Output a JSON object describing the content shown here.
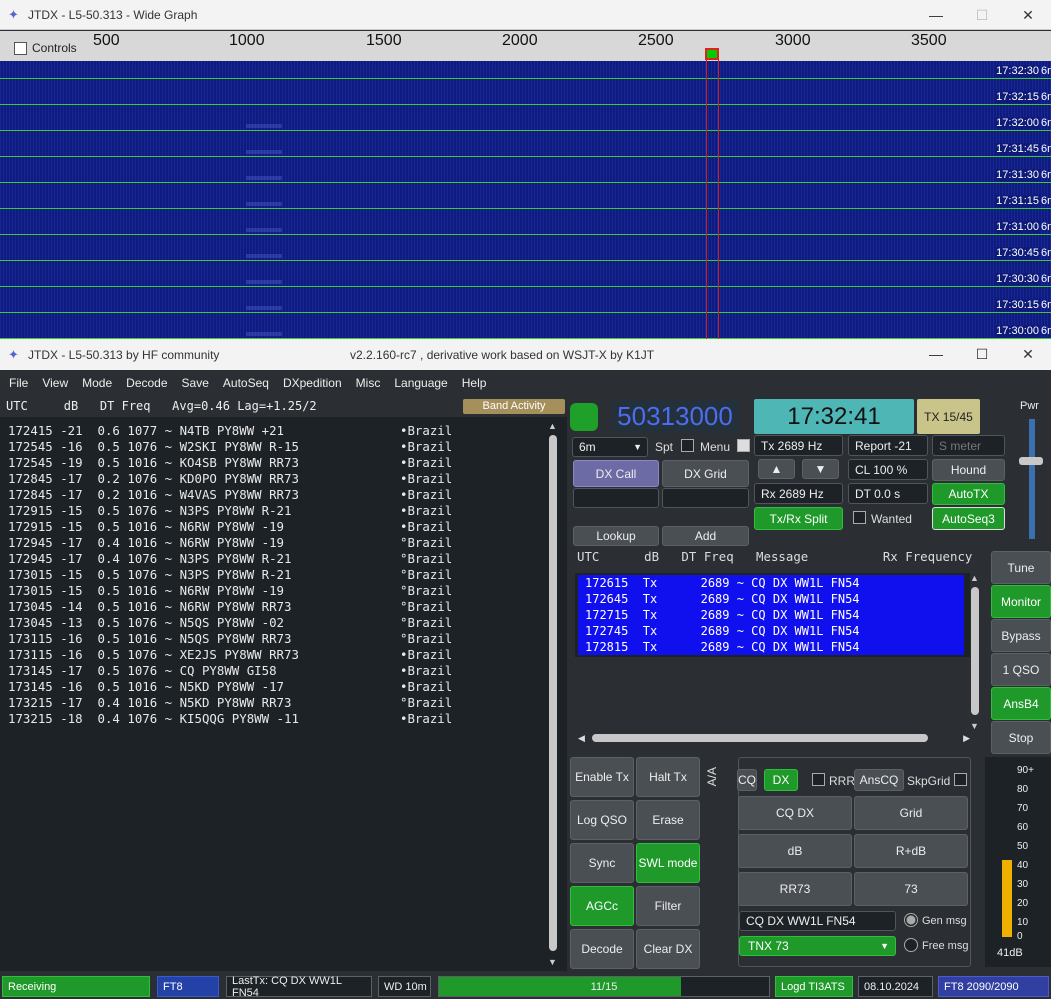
{
  "wide_graph": {
    "title": "JTDX - L5-50.313 - Wide Graph",
    "controls_label": "Controls",
    "scale_ticks": [
      "500",
      "1000",
      "1500",
      "2000",
      "2500",
      "3000",
      "3500"
    ],
    "timestamps": [
      "17:32:30",
      "17:32:15",
      "17:32:00",
      "17:31:45",
      "17:31:30",
      "17:31:15",
      "17:31:00",
      "17:30:45",
      "17:30:30",
      "17:30:15",
      "17:30:00"
    ],
    "band_suffix": "6m"
  },
  "main_window": {
    "title": "JTDX - L5-50.313  by HF community",
    "subtitle": "v2.2.160-rc7 , derivative work based on WSJT-X by K1JT"
  },
  "menu": [
    "File",
    "View",
    "Mode",
    "Decode",
    "Save",
    "AutoSeq",
    "DXpedition",
    "Misc",
    "Language",
    "Help"
  ],
  "band_header": {
    "columns": "UTC     dB   DT Freq   Avg=0.46 Lag=+1.25/2",
    "band_activity_button": "Band Activity"
  },
  "decodes": [
    {
      "line": "172415 -21  0.6 1077 ~ N4TB PY8WW +21",
      "country": "•Brazil"
    },
    {
      "line": "172545 -16  0.5 1076 ~ W2SKI PY8WW R-15",
      "country": "•Brazil"
    },
    {
      "line": "172545 -19  0.5 1016 ~ KO4SB PY8WW RR73",
      "country": "•Brazil"
    },
    {
      "line": "172845 -17  0.2 1076 ~ KD0PO PY8WW RR73",
      "country": "•Brazil"
    },
    {
      "line": "172845 -17  0.2 1016 ~ W4VAS PY8WW RR73",
      "country": "•Brazil"
    },
    {
      "line": "172915 -15  0.5 1076 ~ N3PS PY8WW R-21",
      "country": "•Brazil"
    },
    {
      "line": "172915 -15  0.5 1016 ~ N6RW PY8WW -19",
      "country": "•Brazil"
    },
    {
      "line": "172945 -17  0.4 1016 ~ N6RW PY8WW -19",
      "country": "°Brazil"
    },
    {
      "line": "172945 -17  0.4 1076 ~ N3PS PY8WW R-21",
      "country": "°Brazil"
    },
    {
      "line": "173015 -15  0.5 1076 ~ N3PS PY8WW R-21",
      "country": "°Brazil"
    },
    {
      "line": "173015 -15  0.5 1016 ~ N6RW PY8WW -19",
      "country": "°Brazil"
    },
    {
      "line": "173045 -14  0.5 1016 ~ N6RW PY8WW RR73",
      "country": "°Brazil"
    },
    {
      "line": "173045 -13  0.5 1076 ~ N5QS PY8WW -02",
      "country": "°Brazil"
    },
    {
      "line": "173115 -16  0.5 1016 ~ N5QS PY8WW RR73",
      "country": "°Brazil"
    },
    {
      "line": "173115 -16  0.5 1076 ~ XE2JS PY8WW RR73",
      "country": "•Brazil"
    },
    {
      "line": "173145 -17  0.5 1076 ~ CQ PY8WW GI58",
      "country": "•Brazil"
    },
    {
      "line": "173145 -16  0.5 1016 ~ N5KD PY8WW -17",
      "country": "•Brazil"
    },
    {
      "line": "173215 -17  0.4 1016 ~ N5KD PY8WW RR73",
      "country": "°Brazil"
    },
    {
      "line": "173215 -18  0.4 1076 ~ KI5QQG PY8WW -11",
      "country": "•Brazil"
    }
  ],
  "controls": {
    "frequency": "50313000",
    "clock": "17:32:41",
    "tx_period": "TX 15/45",
    "band": "6m",
    "spt": "Spt",
    "menu": "Menu",
    "tx_hz": "Tx  2689  Hz",
    "rx_hz": "Rx  2689  Hz",
    "report": "Report -21",
    "s_meter_placeholder": "S meter",
    "cl": "CL  100 %",
    "dt": "DT 0.0 s",
    "hound": "Hound",
    "autotx": "AutoTX",
    "wanted": "Wanted",
    "autoseq3": "AutoSeq3",
    "txrx_split": "Tx/Rx Split",
    "dx_call": "DX Call",
    "dx_grid": "DX Grid",
    "lookup": "Lookup",
    "add": "Add",
    "pwr": "Pwr"
  },
  "tx_list": {
    "header": "UTC      dB   DT Freq   Message          Rx Frequency",
    "rows": [
      "172615  Tx      2689 ~ CQ DX WW1L FN54",
      "172645  Tx      2689 ~ CQ DX WW1L FN54",
      "172715  Tx      2689 ~ CQ DX WW1L FN54",
      "172745  Tx      2689 ~ CQ DX WW1L FN54",
      "172815  Tx      2689 ~ CQ DX WW1L FN54"
    ]
  },
  "side_buttons": [
    "Tune",
    "Monitor",
    "Bypass",
    "1 QSO",
    "AnsB4",
    "Stop"
  ],
  "action_buttons": [
    "Enable Tx",
    "Halt Tx",
    "Log QSO",
    "Erase",
    "Sync",
    "SWL mode",
    "AGCc",
    "Filter",
    "Decode",
    "Clear DX"
  ],
  "generator": {
    "cq": "CQ",
    "dx": "DX",
    "rrr": "RRR",
    "anscq": "AnsCQ",
    "skpgrid": "SkpGrid",
    "cqdx": "CQ DX",
    "grid": "Grid",
    "db": "dB",
    "rdb": "R+dB",
    "rr73": "RR73",
    "s73": "73",
    "message": "CQ DX WW1L FN54",
    "tnx": "TNX 73",
    "gen_msg": "Gen msg",
    "free_msg": "Free msg",
    "vertical_label": "A/A"
  },
  "meter": {
    "labels": [
      "90+",
      "80",
      "70",
      "60",
      "50",
      "40",
      "30",
      "20",
      "10",
      "0"
    ],
    "value": "41dB",
    "level_db": 41
  },
  "status": {
    "receiving": "Receiving",
    "mode": "FT8",
    "last_tx": "LastTx: CQ DX WW1L FN54",
    "wd": "WD 10m",
    "progress": "11/15",
    "progress_fraction": 0.7333,
    "logd": "Logd TI3ATS",
    "date": "08.10.2024",
    "ft8_count": "FT8  2090/2090"
  }
}
